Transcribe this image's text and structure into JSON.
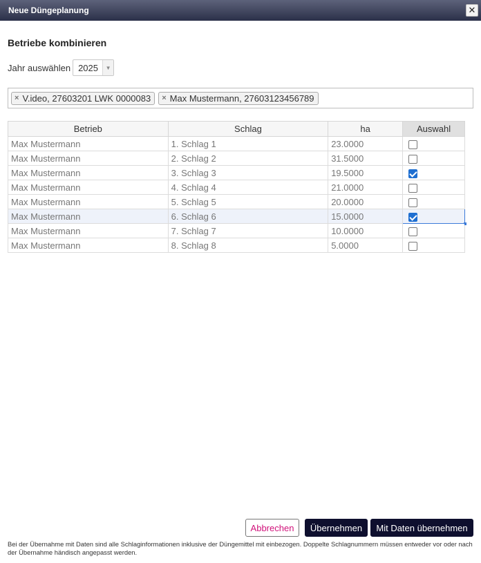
{
  "dialog": {
    "title": "Neue Düngeplanung",
    "close_glyph": "✕"
  },
  "heading": "Betriebe kombinieren",
  "year": {
    "label": "Jahr auswählen",
    "value": "2025"
  },
  "tags": [
    "V.ideo, 27603201 LWK 0000083",
    "Max Mustermann, 27603123456789"
  ],
  "table": {
    "headers": [
      "Betrieb",
      "Schlag",
      "ha",
      "Auswahl"
    ],
    "rows": [
      {
        "betrieb": "Max Mustermann",
        "schlag": "1. Schlag 1",
        "ha": "23.0000",
        "checked": false
      },
      {
        "betrieb": "Max Mustermann",
        "schlag": "2. Schlag 2",
        "ha": "31.5000",
        "checked": false
      },
      {
        "betrieb": "Max Mustermann",
        "schlag": "3. Schlag 3",
        "ha": "19.5000",
        "checked": true
      },
      {
        "betrieb": "Max Mustermann",
        "schlag": "4. Schlag 4",
        "ha": "21.0000",
        "checked": false
      },
      {
        "betrieb": "Max Mustermann",
        "schlag": "5. Schlag 5",
        "ha": "20.0000",
        "checked": false
      },
      {
        "betrieb": "Max Mustermann",
        "schlag": "6. Schlag 6",
        "ha": "15.0000",
        "checked": true
      },
      {
        "betrieb": "Max Mustermann",
        "schlag": "7. Schlag 7",
        "ha": "10.0000",
        "checked": false
      },
      {
        "betrieb": "Max Mustermann",
        "schlag": "8. Schlag 8",
        "ha": "5.0000",
        "checked": false
      }
    ]
  },
  "buttons": {
    "cancel": "Abbrechen",
    "apply": "Übernehmen",
    "apply_with_data": "Mit Daten übernehmen"
  },
  "note": "Bei der Übernahme mit Daten sind alle Schlaginformationen inklusive der Düngemittel mit einbezogen. Doppelte Schlagnummern müssen entweder vor oder nach der Übernahme händisch angepasst werden.",
  "colors": {
    "accent": "#1f6fd1",
    "cancel_text": "#d0117a",
    "primary_button": "#0e0f2e"
  }
}
